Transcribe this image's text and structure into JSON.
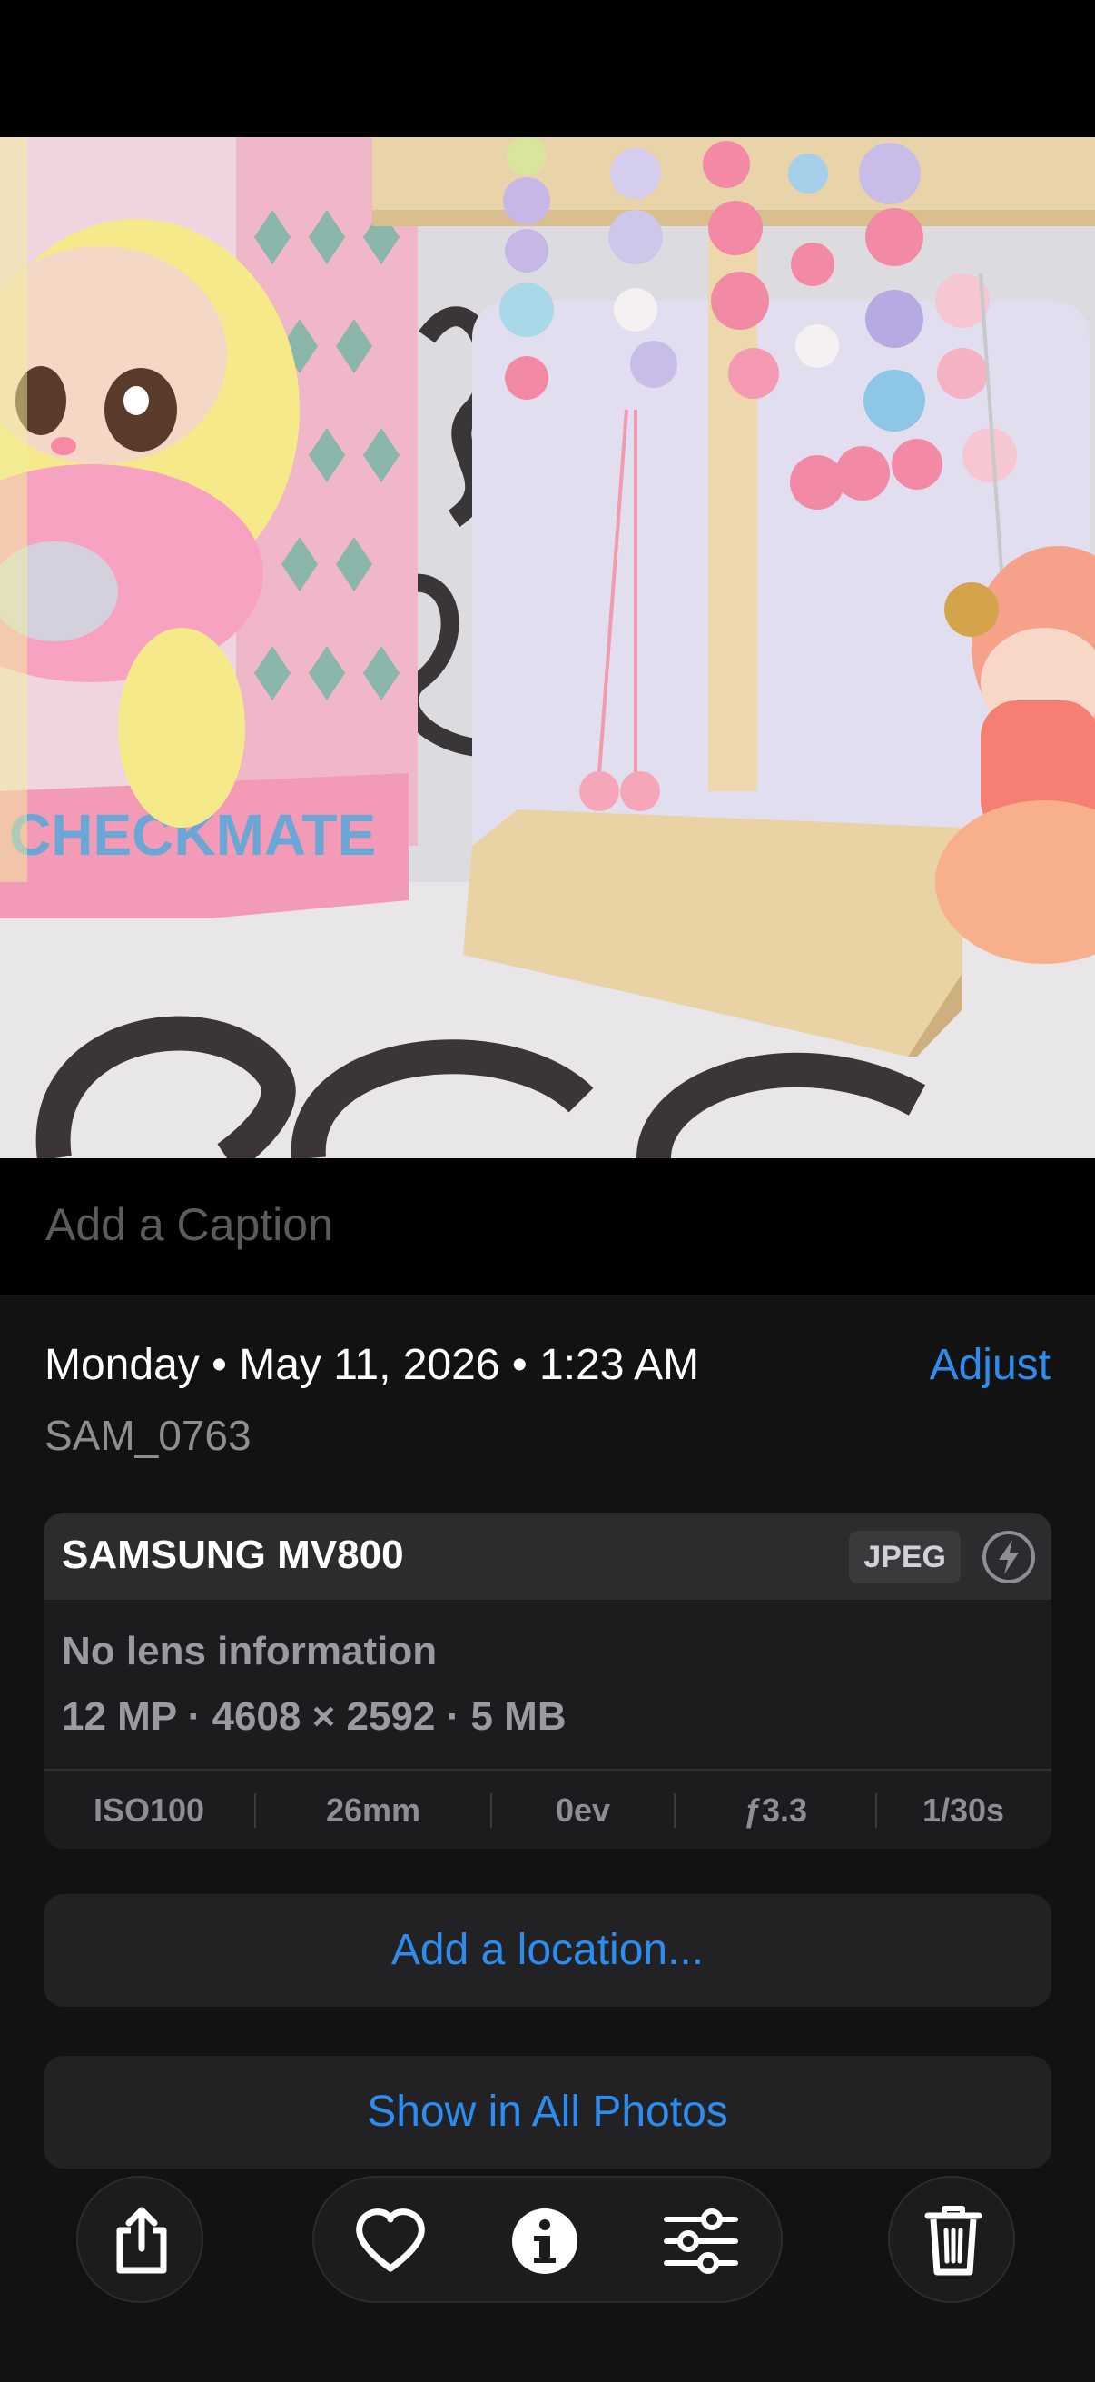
{
  "photo": {
    "label": "CHECKMATE",
    "description_icon": "photo"
  },
  "caption": {
    "placeholder": "Add a Caption"
  },
  "info": {
    "date_line": "Monday • May 11, 2026 • 1:23 AM",
    "adjust_label": "Adjust",
    "filename": "SAM_0763",
    "camera": {
      "model": "SAMSUNG MV800",
      "format": "JPEG",
      "flash_icon": "flash-icon",
      "lens": "No lens information",
      "specs": "12 MP · 4608 × 2592 · 5 MB",
      "exif": {
        "iso": "ISO100",
        "focal": "26mm",
        "ev": "0ev",
        "aperture": "ƒ3.3",
        "shutter": "1/30s"
      }
    },
    "add_location_label": "Add a location...",
    "show_all_label": "Show in All Photos"
  },
  "toolbar": {
    "share_icon": "share-icon",
    "favorite_icon": "heart-icon",
    "info_icon": "info-icon",
    "edit_icon": "sliders-icon",
    "delete_icon": "trash-icon"
  },
  "colors": {
    "accent": "#2d8cf0",
    "background": "#000000",
    "panel": "#121212",
    "card": "#1c1c1e"
  }
}
